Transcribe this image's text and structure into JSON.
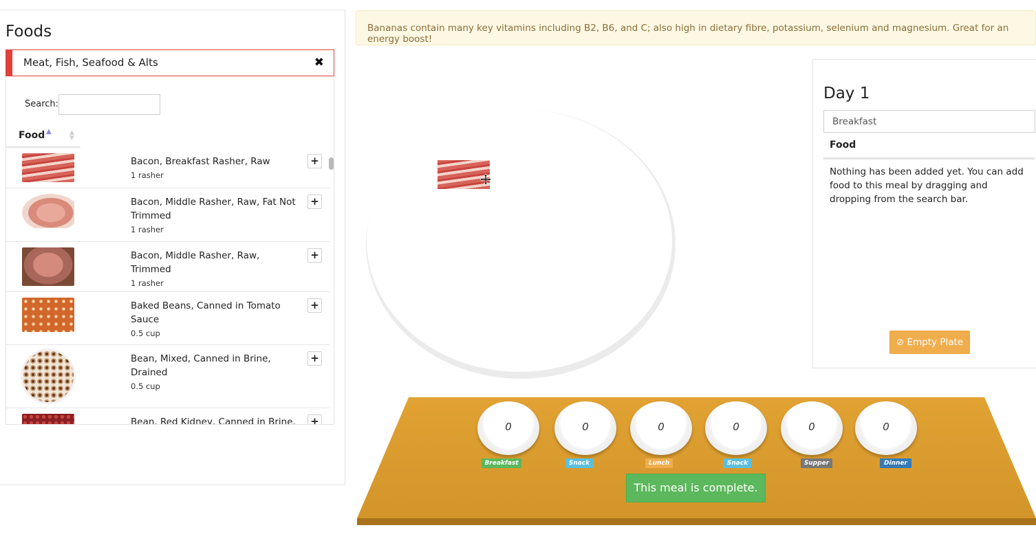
{
  "foods_panel": {
    "title": "Foods",
    "category": "Meat, Fish, Seafood & Alts",
    "close_glyph": "✖",
    "search_label": "Search:",
    "search_value": "",
    "column_header": "Food",
    "items": [
      {
        "name": "Bacon, Breakfast Rasher, Raw",
        "portion": "1 rasher",
        "thumb": "bacon-rasher"
      },
      {
        "name": "Bacon, Middle Rasher, Raw, Fat Not Trimmed",
        "portion": "1 rasher",
        "thumb": "bacon-middle"
      },
      {
        "name": "Bacon, Middle Rasher, Raw, Trimmed",
        "portion": "1 rasher",
        "thumb": "bacon-trimmed"
      },
      {
        "name": "Baked Beans, Canned in Tomato Sauce",
        "portion": "0.5 cup",
        "thumb": "baked-beans"
      },
      {
        "name": "Bean, Mixed, Canned in Brine, Drained",
        "portion": "0.5 cup",
        "thumb": "mixed-beans"
      },
      {
        "name": "Bean, Red Kidney, Canned in Brine,",
        "portion": "",
        "thumb": "kidney-beans"
      }
    ],
    "add_glyph": "+"
  },
  "tip": "Bananas contain many key vitamins including B2, B6, and C; also high in dietary fibre, potassium, selenium and magnesium. Great for an energy boost!",
  "plate": {
    "dragged_item": "Bacon, Breakfast Rasher, Raw",
    "cursor_icon": "move-cursor-icon"
  },
  "day_panel": {
    "title": "Day 1",
    "meal": "Breakfast",
    "column_header": "Food",
    "empty_text": "Nothing has been added yet. You can add food to this meal by dragging and dropping from the search bar.",
    "empty_plate_label": "⊘ Empty Plate"
  },
  "tray": {
    "meals": [
      {
        "label": "Breakfast",
        "count": "0",
        "color": "#5cb85c"
      },
      {
        "label": "Snack",
        "count": "0",
        "color": "#5bc0de"
      },
      {
        "label": "Lunch",
        "count": "0",
        "color": "#f0ad4e"
      },
      {
        "label": "Snack",
        "count": "0",
        "color": "#5bc0de"
      },
      {
        "label": "Supper",
        "count": "0",
        "color": "#777777"
      },
      {
        "label": "Dinner",
        "count": "0",
        "color": "#337ab7"
      }
    ],
    "complete_label": "This meal is complete."
  },
  "colors": {
    "tray": "#d89c30",
    "category_accent": "#e0403a",
    "tip_bg": "#fcf8e3",
    "tip_text": "#8a6d3b"
  }
}
